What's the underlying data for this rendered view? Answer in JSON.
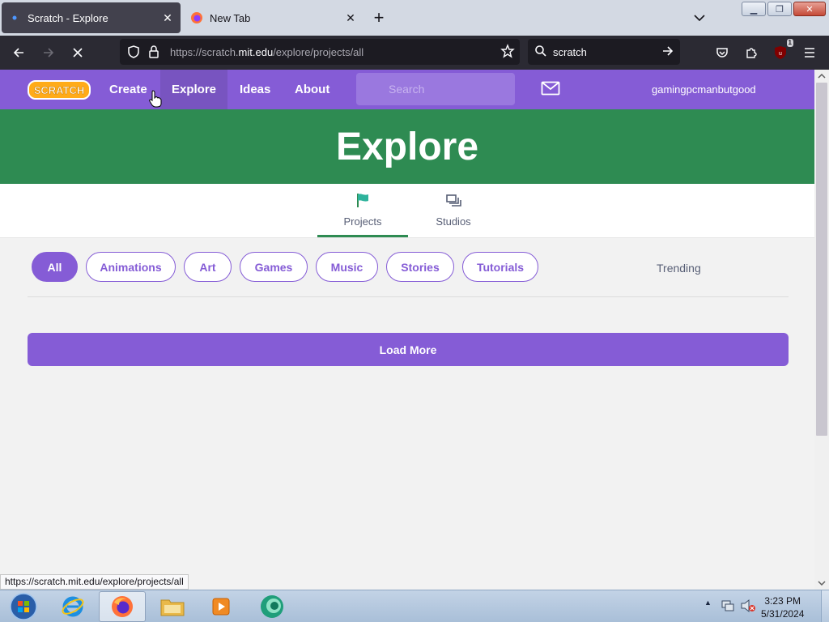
{
  "browser": {
    "tabs": [
      {
        "title": "Scratch - Explore",
        "active": true
      },
      {
        "title": "New Tab",
        "active": false
      }
    ],
    "url": {
      "prefix": "https://scratch.",
      "host": "mit.edu",
      "path": "/explore/projects/all"
    },
    "search_query": "scratch",
    "extension_badge": "1",
    "status_link": "https://scratch.mit.edu/explore/projects/all"
  },
  "scratch": {
    "menu": {
      "create": "Create",
      "explore": "Explore",
      "ideas": "Ideas",
      "about": "About"
    },
    "search_placeholder": "Search",
    "username": "gamingpcmanbutgood",
    "banner_title": "Explore",
    "subtabs": {
      "projects": "Projects",
      "studios": "Studios"
    },
    "filters": [
      "All",
      "Animations",
      "Art",
      "Games",
      "Music",
      "Stories",
      "Tutorials"
    ],
    "active_filter": "All",
    "sort": "Trending",
    "load_more": "Load More",
    "colors": {
      "purple": "#855cd6",
      "green": "#2e8b52"
    }
  },
  "taskbar": {
    "time": "3:23 PM",
    "date": "5/31/2024"
  }
}
